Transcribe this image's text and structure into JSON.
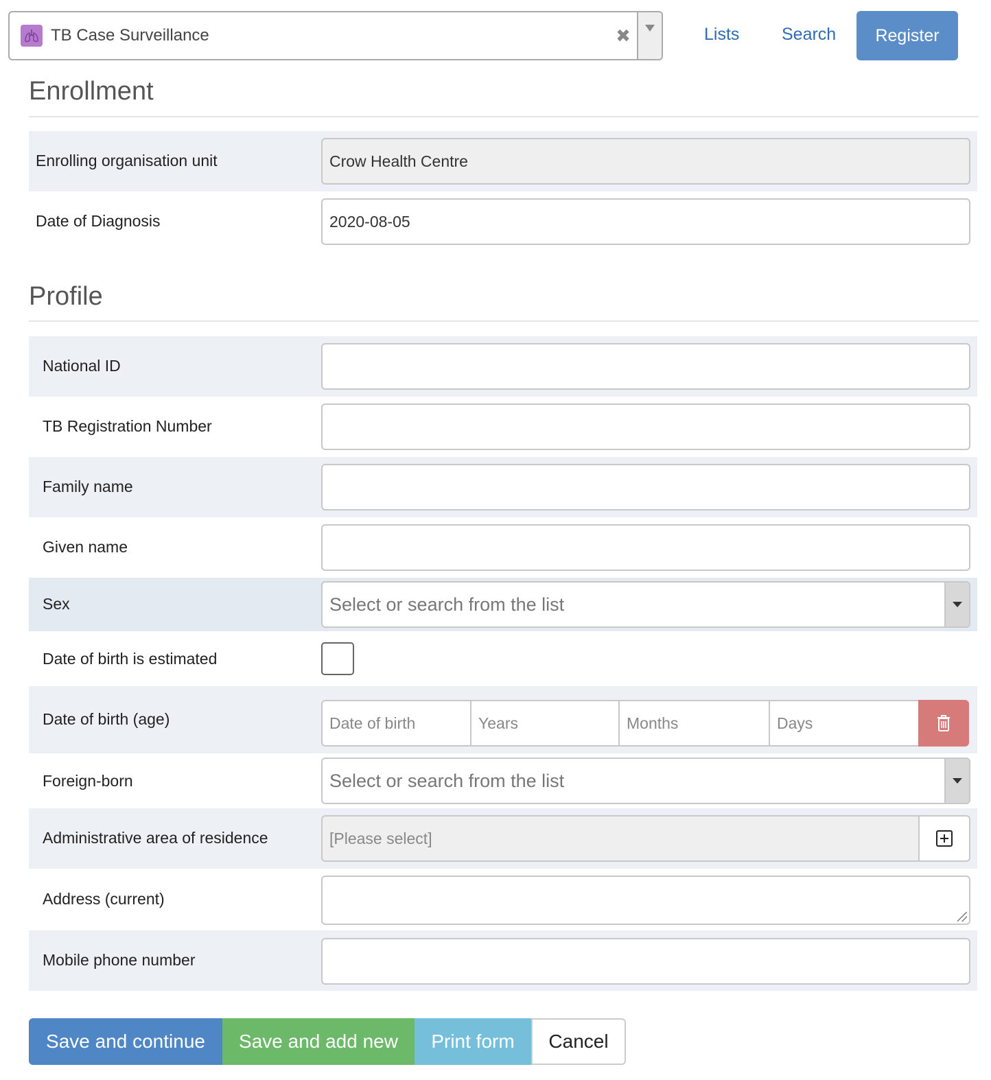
{
  "header": {
    "program": "TB Case Surveillance",
    "nav": {
      "lists": "Lists",
      "search": "Search",
      "register": "Register"
    },
    "icons": {
      "program": "lungs-icon",
      "clear": "close-icon",
      "dropdown": "chevron-down-icon"
    }
  },
  "enrollment": {
    "title": "Enrollment",
    "org_unit": {
      "label": "Enrolling organisation unit",
      "value": "Crow Health Centre"
    },
    "diagnosis_date": {
      "label": "Date of Diagnosis",
      "value": "2020-08-05"
    }
  },
  "profile": {
    "title": "Profile",
    "national_id": {
      "label": "National ID",
      "value": ""
    },
    "tb_reg_number": {
      "label": "TB Registration Number",
      "value": ""
    },
    "family_name": {
      "label": "Family name",
      "value": ""
    },
    "given_name": {
      "label": "Given name",
      "value": ""
    },
    "sex": {
      "label": "Sex",
      "placeholder": "Select or search from the list"
    },
    "dob_estimated": {
      "label": "Date of birth is estimated"
    },
    "dob": {
      "label": "Date of birth (age)",
      "placeholders": {
        "date": "Date of birth",
        "years": "Years",
        "months": "Months",
        "days": "Days"
      }
    },
    "foreign_born": {
      "label": "Foreign-born",
      "placeholder": "Select or search from the list"
    },
    "admin_area": {
      "label": "Administrative area of residence",
      "placeholder": "[Please select]"
    },
    "address": {
      "label": "Address (current)",
      "value": ""
    },
    "mobile": {
      "label": "Mobile phone number",
      "value": ""
    }
  },
  "actions": {
    "save_continue": "Save and continue",
    "save_add_new": "Save and add new",
    "print": "Print form",
    "cancel": "Cancel"
  },
  "colors": {
    "primary": "#4f86c6",
    "success": "#6cb969",
    "info": "#76bfdb",
    "danger": "#d77a7a",
    "link": "#2f6cb3"
  }
}
